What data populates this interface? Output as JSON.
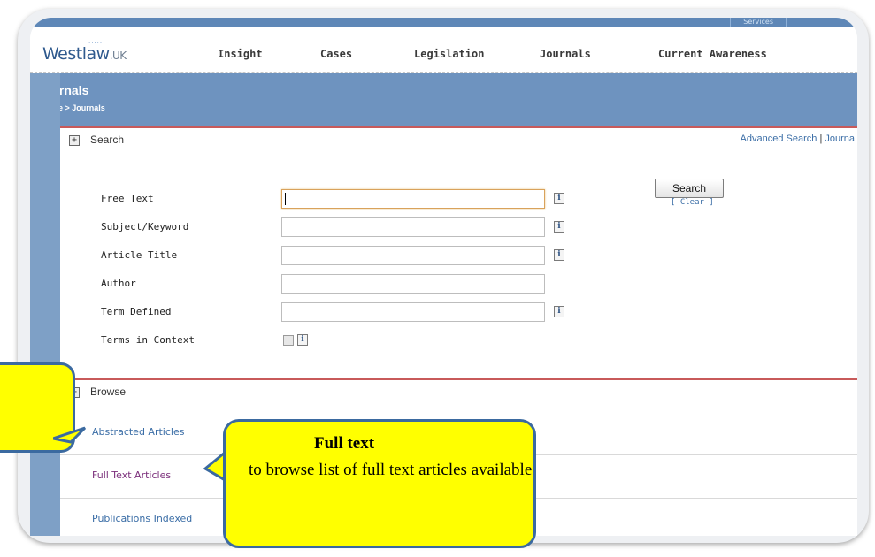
{
  "header": {
    "logo": "Westlaw",
    "logo_suffix": ".UK",
    "services": "Services",
    "tabs": [
      "Insight",
      "Cases",
      "Legislation",
      "Journals",
      "Current Awareness"
    ]
  },
  "page": {
    "title": "Journals",
    "breadcrumb": "Home > Journals"
  },
  "search": {
    "section_label": "Search",
    "advanced_link": "Advanced Search",
    "journal_link": "Journa",
    "fields": [
      "Free Text",
      "Subject/Keyword",
      "Article Title",
      "Author",
      "Term Defined",
      "Terms in Context"
    ],
    "search_button": "Search",
    "clear_link": "[ Clear ]",
    "info_icon_label": "i"
  },
  "browse": {
    "section_label": "Browse",
    "items": [
      "Abstracted Articles",
      "Full Text Articles",
      "Publications Indexed"
    ]
  },
  "callout": {
    "title": "Full text",
    "body": "to browse list of full text articles available"
  },
  "colors": {
    "brand_blue": "#2f5a8e",
    "header_band": "#6e93bf",
    "accent_red": "#c85a5a",
    "link_blue": "#3a6da6",
    "callout_yellow": "#ffff00",
    "visited_purple": "#7b2f7b"
  },
  "icons": [
    "expand-icon",
    "info-icon",
    "checkbox"
  ]
}
